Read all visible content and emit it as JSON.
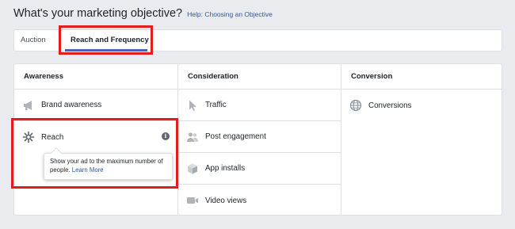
{
  "header": {
    "title": "What's your marketing objective?",
    "help_link": "Help: Choosing an Objective"
  },
  "tabs": [
    {
      "label": "Auction",
      "selected": false
    },
    {
      "label": "Reach and Frequency",
      "selected": true
    }
  ],
  "columns": {
    "awareness": {
      "heading": "Awareness",
      "items": [
        {
          "label": "Brand awareness",
          "icon": "megaphone-icon"
        },
        {
          "label": "Reach",
          "icon": "reach-icon"
        }
      ]
    },
    "consideration": {
      "heading": "Consideration",
      "items": [
        {
          "label": "Traffic",
          "icon": "cursor-icon"
        },
        {
          "label": "Post engagement",
          "icon": "people-icon"
        },
        {
          "label": "App installs",
          "icon": "box-icon"
        },
        {
          "label": "Video views",
          "icon": "video-icon"
        }
      ]
    },
    "conversion": {
      "heading": "Conversion",
      "items": [
        {
          "label": "Conversions",
          "icon": "globe-icon"
        }
      ]
    }
  },
  "tooltip": {
    "text": "Show your ad to the maximum number of people.",
    "link": "Learn More"
  },
  "info_glyph": "i",
  "colors": {
    "background": "#e9ebee",
    "accent_blue": "#4267b2",
    "link_blue": "#365899",
    "highlight_red": "#e41c1c",
    "icon_gray": "#90949c"
  }
}
